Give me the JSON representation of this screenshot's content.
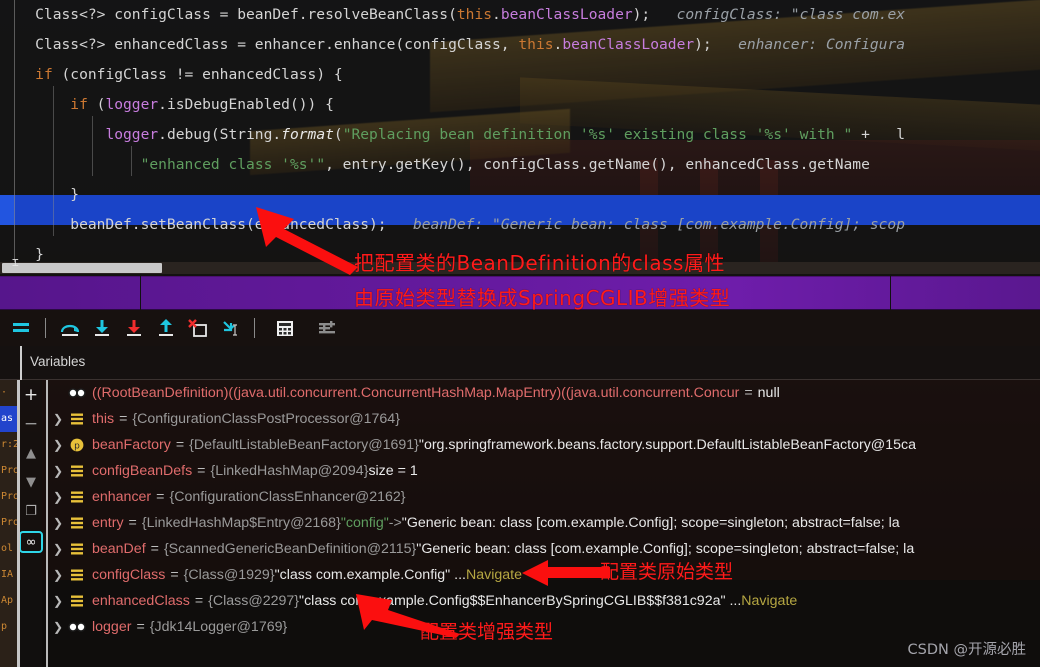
{
  "editor": {
    "lines": [
      {
        "id": "line-config-class",
        "segments": [
          {
            "t": "    Class<?> configClass = beanDef.resolveBeanClass(",
            "c": "plain"
          },
          {
            "t": "this",
            "c": "kw"
          },
          {
            "t": ".",
            "c": "plain"
          },
          {
            "t": "beanClassLoader",
            "c": "fld"
          },
          {
            "t": ");   ",
            "c": "plain"
          },
          {
            "t": "configClass: \"class com.ex",
            "c": "param"
          }
        ]
      },
      {
        "id": "line-enhanced-class",
        "segments": [
          {
            "t": "    Class<?> enhancedClass = enhancer.enhance(configClass, ",
            "c": "plain"
          },
          {
            "t": "this",
            "c": "kw"
          },
          {
            "t": ".",
            "c": "plain"
          },
          {
            "t": "beanClassLoader",
            "c": "fld"
          },
          {
            "t": ");   ",
            "c": "plain"
          },
          {
            "t": "enhancer: Configura",
            "c": "param"
          }
        ]
      },
      {
        "id": "line-if-compare",
        "segments": [
          {
            "t": "    ",
            "c": "plain"
          },
          {
            "t": "if",
            "c": "kw"
          },
          {
            "t": " (configClass != enhancedClass) {",
            "c": "plain"
          }
        ]
      },
      {
        "id": "line-if-debug",
        "segments": [
          {
            "t": "        ",
            "c": "plain"
          },
          {
            "t": "if",
            "c": "kw"
          },
          {
            "t": " (",
            "c": "plain"
          },
          {
            "t": "logger",
            "c": "fld"
          },
          {
            "t": ".isDebugEnabled()) {",
            "c": "plain"
          }
        ]
      },
      {
        "id": "line-logger-debug",
        "segments": [
          {
            "t": "            ",
            "c": "plain"
          },
          {
            "t": "logger",
            "c": "fld"
          },
          {
            "t": ".debug(String.",
            "c": "plain"
          },
          {
            "t": "format",
            "c": "mth"
          },
          {
            "t": "(",
            "c": "plain"
          },
          {
            "t": "\"Replacing bean definition '%s' existing class '%s' with \"",
            "c": "str"
          },
          {
            "t": " + ",
            "c": "plain"
          },
          {
            "t": "  l",
            "c": "plain"
          }
        ]
      },
      {
        "id": "line-enhanced-str",
        "segments": [
          {
            "t": "                ",
            "c": "plain"
          },
          {
            "t": "\"enhanced class '%s'\"",
            "c": "str"
          },
          {
            "t": ", entry.getKey(), configClass.getName(), enhancedClass.getName",
            "c": "plain"
          }
        ]
      },
      {
        "id": "line-close-if-debug",
        "segments": [
          {
            "t": "        }",
            "c": "plain"
          }
        ]
      },
      {
        "id": "line-set-bean-class",
        "highlighted": true,
        "segments": [
          {
            "t": "        beanDef.setBeanClass(enhancedClass);   ",
            "c": "plain"
          },
          {
            "t": "beanDef: \"Generic bean: class [com.example.Config]; scop",
            "c": "paramv"
          }
        ]
      },
      {
        "id": "line-close-if",
        "segments": [
          {
            "t": "    }",
            "c": "plain"
          }
        ]
      }
    ]
  },
  "annotations": {
    "banner_line1": "把配置类的BeanDefinition的class属性",
    "banner_line2": "由原始类型替换成SpringCGLIB增强类型",
    "config_original": "配置类原始类型",
    "config_enhanced": "配置类增强类型"
  },
  "debug_toolbar": {
    "buttons": [
      {
        "name": "show-execution-point-button",
        "icon": "lines-icon",
        "label": "Show Execution Point"
      },
      {
        "name": "step-over-button",
        "icon": "step-over-icon",
        "label": "Step Over"
      },
      {
        "name": "step-into-button",
        "icon": "step-into-icon",
        "label": "Step Into"
      },
      {
        "name": "force-step-into-button",
        "icon": "force-step-into-icon",
        "label": "Force Step Into"
      },
      {
        "name": "step-out-button",
        "icon": "step-out-icon",
        "label": "Step Out"
      },
      {
        "name": "drop-frame-button",
        "icon": "drop-frame-icon",
        "label": "Drop Frame"
      },
      {
        "name": "run-to-cursor-button",
        "icon": "run-to-cursor-icon",
        "label": "Run to Cursor"
      },
      {
        "name": "evaluate-expression-button",
        "icon": "calculator-icon",
        "label": "Evaluate Expression"
      },
      {
        "name": "settings-button",
        "icon": "sliders-icon",
        "label": "Settings"
      }
    ]
  },
  "variables_panel": {
    "tab_label": "Variables",
    "side_buttons": [
      {
        "name": "add-watch-button",
        "icon": "plus-icon",
        "label": "+"
      },
      {
        "name": "remove-watch-button",
        "icon": "minus-icon",
        "label": "−"
      },
      {
        "name": "move-up-button",
        "icon": "arrow-up-icon",
        "label": "▲"
      },
      {
        "name": "move-down-button",
        "icon": "arrow-down-icon",
        "label": "▼"
      },
      {
        "name": "copy-value-button",
        "icon": "copy-icon",
        "label": "⧉"
      },
      {
        "name": "watches-toggle-button",
        "icon": "glasses-icon",
        "label": "oo"
      }
    ],
    "rows": [
      {
        "id": "row-rootbeandefinition",
        "expandable": false,
        "icon": "glasses-icon",
        "name": "((RootBeanDefinition)((java.util.concurrent.ConcurrentHashMap.MapEntry)((java.util.concurrent.Concur",
        "eq": "=",
        "value": "null",
        "value_class": "vnull",
        "navigate": ""
      },
      {
        "id": "row-this",
        "expandable": true,
        "icon": "field-icon",
        "name": "this",
        "eq": "=",
        "value": "{ConfigurationClassPostProcessor@1764}",
        "value_class": "vref",
        "navigate": ""
      },
      {
        "id": "row-beanfactory",
        "expandable": true,
        "icon": "param-icon",
        "name": "beanFactory",
        "eq": "=",
        "value": "{DefaultListableBeanFactory@1691}",
        "value_class": "vref",
        "extra": "\"org.springframework.beans.factory.support.DefaultListableBeanFactory@15ca",
        "extra_class": "vstr",
        "navigate": ""
      },
      {
        "id": "row-configbeandefs",
        "expandable": true,
        "icon": "field-icon",
        "name": "configBeanDefs",
        "eq": "=",
        "value": "{LinkedHashMap@2094}",
        "value_class": "vref",
        "extra": "size = 1",
        "extra_class": "vsize",
        "navigate": ""
      },
      {
        "id": "row-enhancer",
        "expandable": true,
        "icon": "field-icon",
        "name": "enhancer",
        "eq": "=",
        "value": "{ConfigurationClassEnhancer@2162}",
        "value_class": "vref",
        "navigate": ""
      },
      {
        "id": "row-entry",
        "expandable": true,
        "icon": "field-icon",
        "name": "entry",
        "eq": "=",
        "value": "{LinkedHashMap$Entry@2168}",
        "value_class": "vref",
        "key": "\"config\"",
        "arrow": "->",
        "extra": "\"Generic bean: class [com.example.Config]; scope=singleton; abstract=false; la",
        "extra_class": "vstr",
        "navigate": ""
      },
      {
        "id": "row-beandef",
        "expandable": true,
        "icon": "field-icon",
        "name": "beanDef",
        "eq": "=",
        "value": "{ScannedGenericBeanDefinition@2115}",
        "value_class": "vref",
        "extra": "\"Generic bean: class [com.example.Config]; scope=singleton; abstract=false; la",
        "extra_class": "vstr",
        "navigate": ""
      },
      {
        "id": "row-configclass",
        "expandable": true,
        "icon": "field-icon",
        "name": "configClass",
        "eq": "=",
        "value": "{Class@1929}",
        "value_class": "vref",
        "extra": "\"class com.example.Config\" ...",
        "extra_class": "vstr",
        "navigate": "Navigate"
      },
      {
        "id": "row-enhancedclass",
        "expandable": true,
        "icon": "field-icon",
        "name": "enhancedClass",
        "eq": "=",
        "value": "{Class@2297}",
        "value_class": "vref",
        "extra": "\"class com.example.Config$$EnhancerBySpringCGLIB$$f381c92a\" ...",
        "extra_class": "vstr",
        "navigate": "Navigate"
      },
      {
        "id": "row-logger",
        "expandable": true,
        "icon": "glasses-icon",
        "name": "logger",
        "eq": "=",
        "value": "{Jdk14Logger@1769}",
        "value_class": "vref",
        "navigate": ""
      }
    ]
  },
  "watermark": {
    "text": "CSDN @开源必胜"
  },
  "colors": {
    "highlight_line": "#1a44c8",
    "banner_purple": "#761eb8",
    "annotation_red": "#ff1a1a",
    "keyword_orange": "#cc7832",
    "string_green": "#5f9e5f",
    "field_purple": "#c77dde",
    "var_name_red": "#e06c6c",
    "navigate_olive": "#b5a642",
    "accent_cyan": "#2fd6e8"
  }
}
